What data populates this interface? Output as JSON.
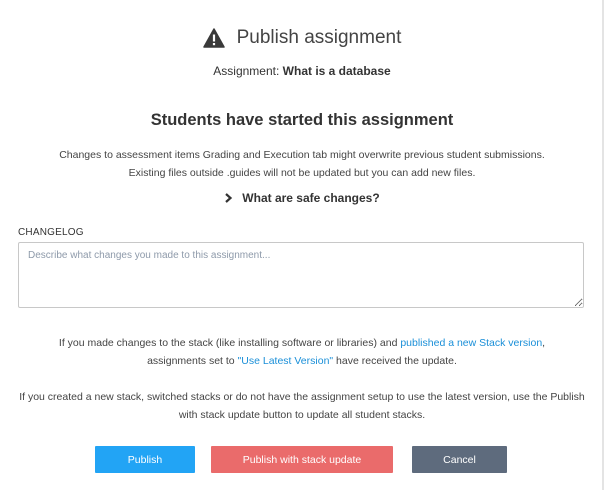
{
  "header": {
    "title": "Publish assignment",
    "icon": "warning-triangle-icon"
  },
  "assignment": {
    "label": "Assignment: ",
    "name": "What is a database"
  },
  "notice": {
    "heading": "Students have started this assignment",
    "line1": "Changes to assessment items Grading and Execution tab might overwrite previous student submissions.",
    "line2": "Existing files outside .guides will not be updated but you can add new files."
  },
  "safe_changes": {
    "label": "What are safe changes?",
    "icon": "chevron-right-icon"
  },
  "changelog": {
    "label": "CHANGELOG",
    "placeholder": "Describe what changes you made to this assignment...",
    "value": ""
  },
  "stack_info": {
    "part1": "If you made changes to the stack (like installing software or libraries) and ",
    "link1": "published a new Stack version",
    "part2": ",",
    "part3": "assignments set to ",
    "link2": "\"Use Latest Version\"",
    "part4": " have received the update."
  },
  "new_stack_info": {
    "text": "If you created a new stack, switched stacks or do not have the assignment setup to use the latest version, use the Publish with stack update button to update all student stacks."
  },
  "buttons": {
    "publish": "Publish",
    "publish_stack": "Publish with stack update",
    "cancel": "Cancel"
  },
  "colors": {
    "publish": "#22a4f5",
    "publish_stack": "#ea6b6b",
    "cancel": "#5e6b7d",
    "link": "#1a8fd8"
  }
}
